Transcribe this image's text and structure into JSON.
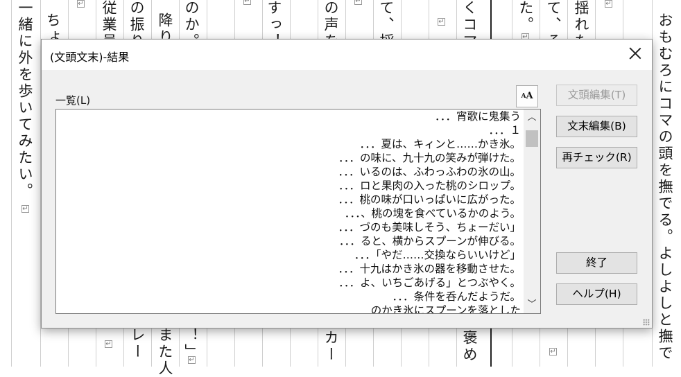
{
  "background": {
    "columns": [
      {
        "text": "一緒に外を歩いてみたい。"
      },
      {
        "text": "ちょ"
      },
      {
        "text": "従業員"
      },
      {
        "text": "の振り"
      },
      {
        "text": "降り"
      },
      {
        "text": "のか。"
      },
      {
        "text": "すっ！"
      },
      {
        "text": "の声を"
      },
      {
        "text": "て、採"
      },
      {
        "text": "くコマ"
      },
      {
        "text": "た。"
      },
      {
        "text": "て、そ"
      },
      {
        "text": "揺れた"
      },
      {
        "text": "おもむろにコマの頭を撫でる。よしよしと撫で"
      }
    ],
    "bottom_fragments": [
      {
        "text": "レー"
      },
      {
        "text": "また人"
      },
      {
        "text": "！」"
      },
      {
        "text": "カー"
      },
      {
        "text": "褒め"
      },
      {
        "text": "。"
      }
    ]
  },
  "dialog": {
    "title": "(文頭文末)-結果",
    "list_label": "一覧(L)",
    "font_button": {
      "big": "A",
      "small": "A"
    },
    "list_rows": [
      "．．．宵歌に鬼集う",
      "．．．１",
      "．．．夏は、キィンと……かき氷。",
      "．．．の味に、九十九の笑みが弾けた。",
      "．．．いるのは、ふわっふわの氷の山。",
      "．．．ロと果肉の入った桃のシロップ。",
      "．．．桃の味が口いっぱいに広がった。",
      "．．．、桃の塊を食べているかのよう。",
      "．．．づのも美味しそう、ちょーだい」",
      "．．．ると、横からスプーンが伸びる。",
      "．．．「やだ……交換ならいいけど」",
      "．．．十九はかき氷の器を移動させた。",
      "．．．よ、いちごあげる」とつぶやく。",
      "．．．条件を呑んだようだ。",
      "のかき氷にスプーンを落とした"
    ],
    "buttons": {
      "head_edit": "文頭編集(T)",
      "tail_edit": "文末編集(B)",
      "recheck": "再チェック(R)",
      "finish": "終了",
      "help": "ヘルプ(H)"
    }
  }
}
